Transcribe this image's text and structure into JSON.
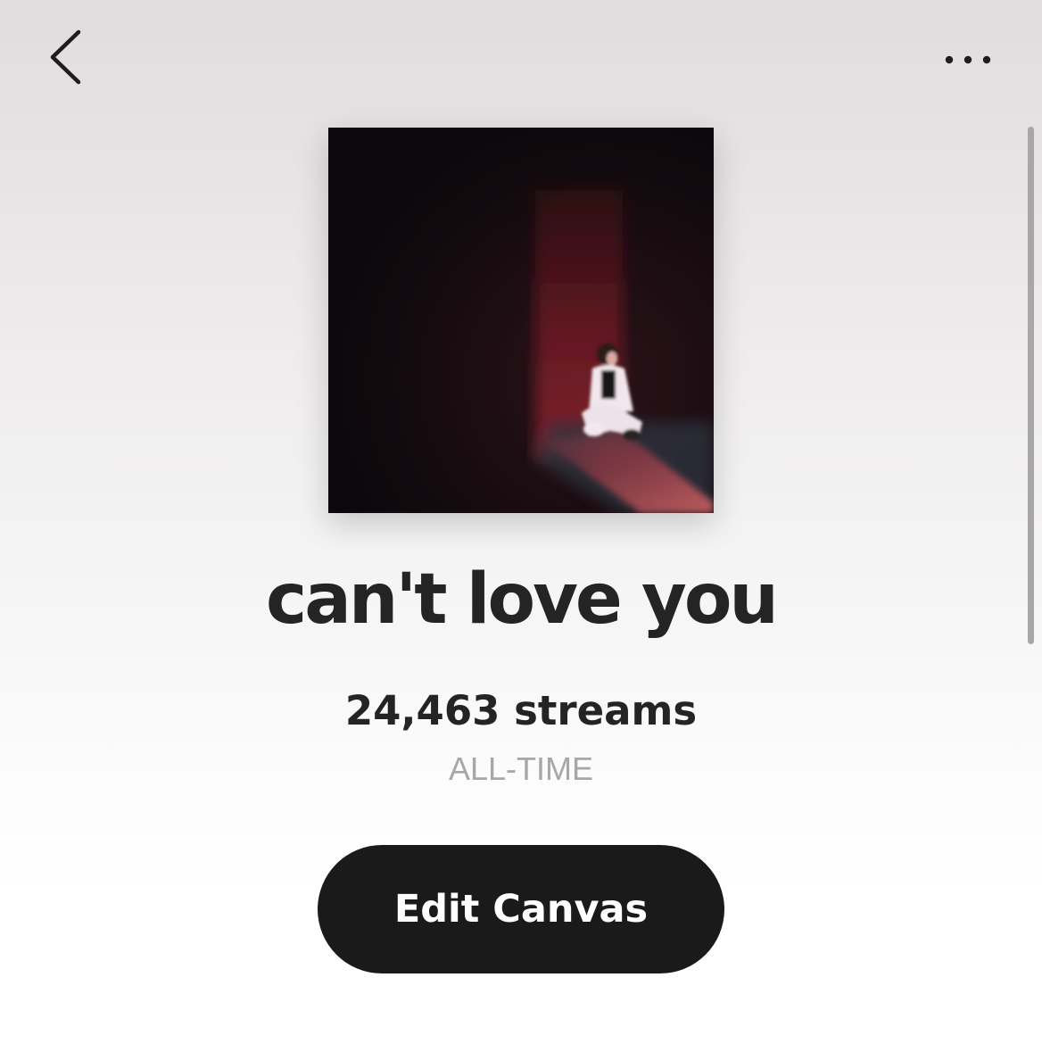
{
  "header": {
    "back_icon": "chevron-left-icon",
    "more_icon": "more-horizontal-icon"
  },
  "track": {
    "title": "can't love you",
    "streams": "24,463 streams",
    "period": "ALL-TIME"
  },
  "actions": {
    "edit_canvas_label": "Edit Canvas"
  },
  "colors": {
    "text": "#242424",
    "muted": "#a7a7a7",
    "button_bg": "#1a1a1a",
    "button_text": "#ffffff"
  }
}
